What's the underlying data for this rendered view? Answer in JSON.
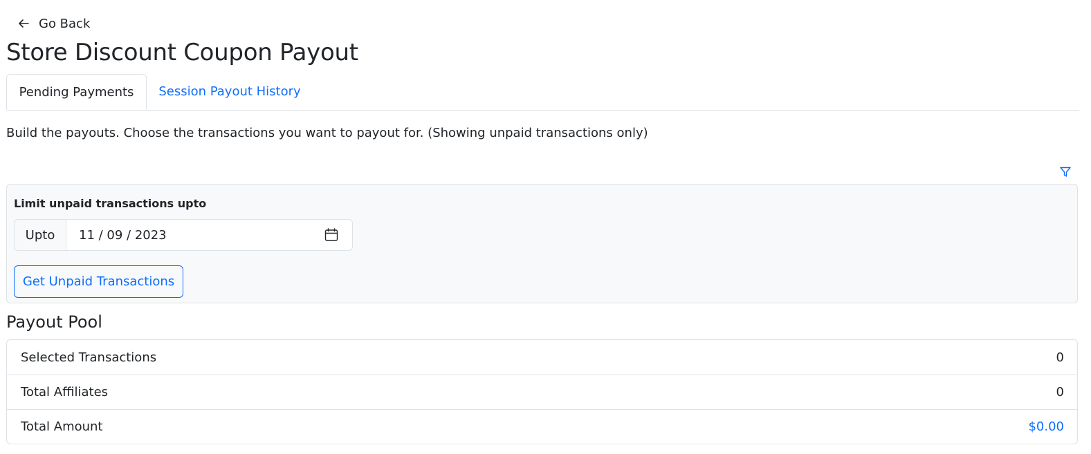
{
  "nav": {
    "go_back_label": "Go Back"
  },
  "page": {
    "title": "Store Discount Coupon Payout"
  },
  "tabs": [
    {
      "label": "Pending Payments",
      "active": true
    },
    {
      "label": "Session Payout History",
      "active": false
    }
  ],
  "intro_text": "Build the payouts. Choose the transactions you want to payout for. (Showing unpaid transactions only)",
  "filter": {
    "heading": "Limit unpaid transactions upto",
    "addon_label": "Upto",
    "date_value": "11 / 09 / 2023",
    "button_label": "Get Unpaid Transactions"
  },
  "pool": {
    "title": "Payout Pool",
    "rows": [
      {
        "label": "Selected Transactions",
        "value": "0"
      },
      {
        "label": "Total Affiliates",
        "value": "0"
      },
      {
        "label": "Total Amount",
        "value": "$0.00"
      }
    ]
  },
  "colors": {
    "link": "#0d6efd",
    "text": "#212529",
    "border": "#dee2e6",
    "panel_bg": "#f8f9fa"
  },
  "icons": {
    "back": "arrow-left-icon",
    "filter": "filter-icon",
    "calendar": "calendar-icon"
  }
}
